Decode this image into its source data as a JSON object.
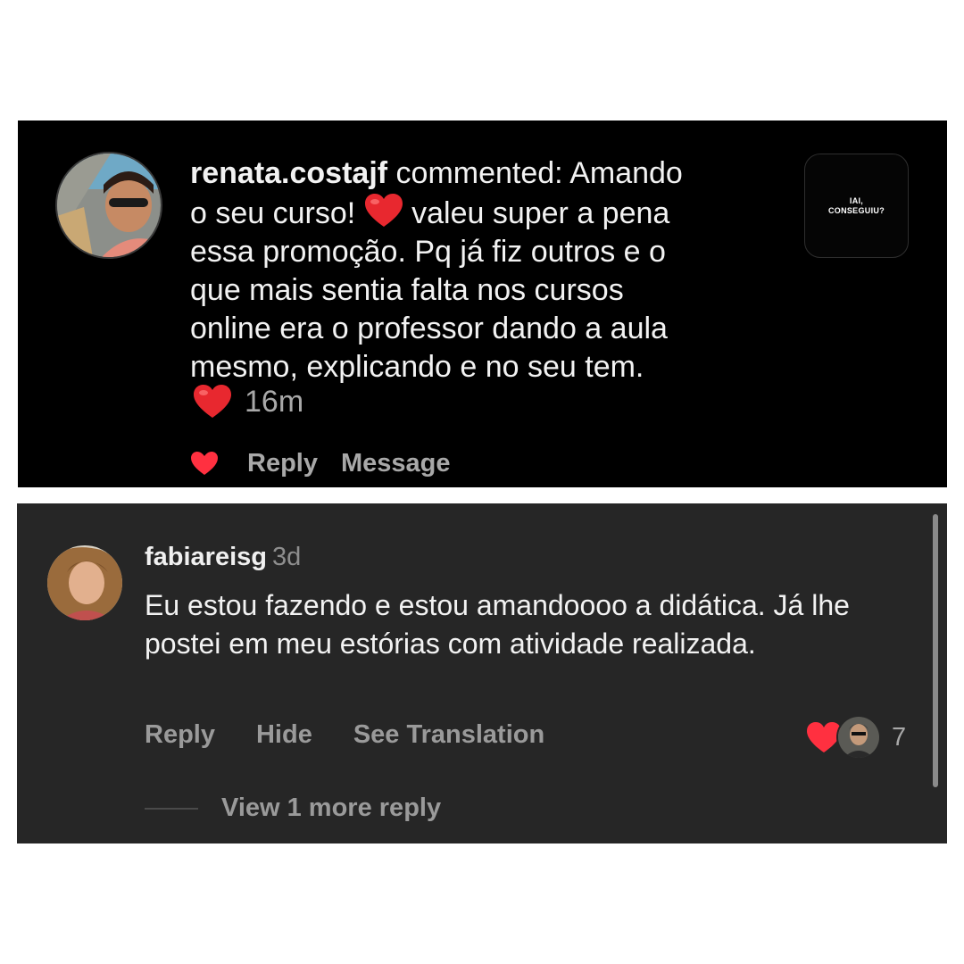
{
  "comment1": {
    "username": "renata.costajf",
    "text_part1": " commented: Amando\no seu curso! ",
    "text_part2": "  valeu super a pena\nessa promoção.  Pq já fiz outros e o\nque mais sentia falta nos cursos\nonline era o professor dando a aula\nmesmo, explicando e no seu tem.",
    "time": "16m",
    "reply_label": "Reply",
    "message_label": "Message",
    "thumbnail": {
      "line1": "IAI,",
      "line2": "CONSEGUIU?"
    },
    "heart_color": "#ff3040"
  },
  "comment2": {
    "username": "fabiareisg",
    "time": "3d",
    "text": "Eu estou fazendo e estou amandoooo a didática. Já lhe postei em meu estórias com atividade realizada.",
    "actions": {
      "reply": "Reply",
      "hide": "Hide",
      "see_translation": "See Translation"
    },
    "like_count": "7",
    "view_more": "View 1 more reply"
  },
  "icons": {
    "emoji_heart": "red-heart-emoji-icon",
    "like": "heart-icon",
    "liker": "liker-avatar"
  }
}
